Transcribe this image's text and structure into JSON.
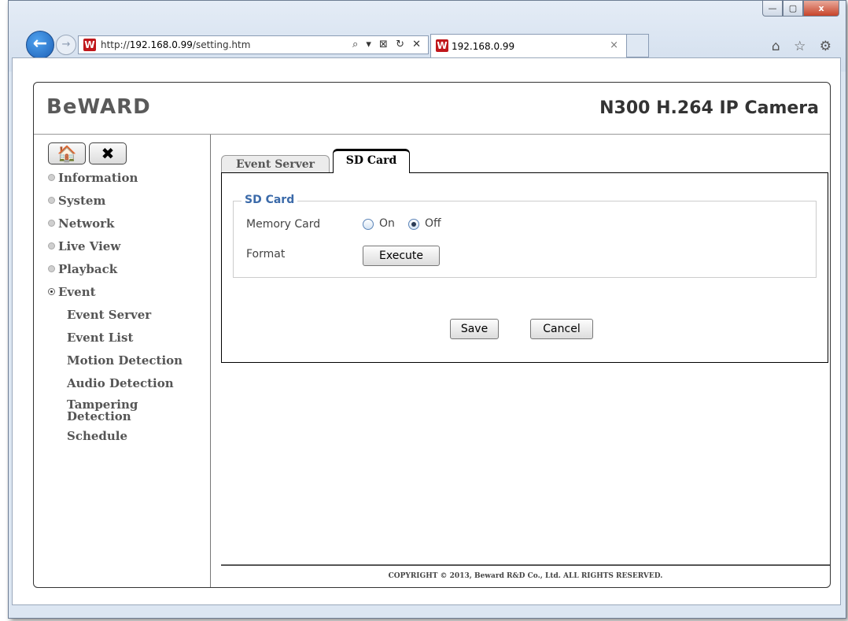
{
  "browser": {
    "url_prefix": "http://",
    "url_host": "192.168.0.99",
    "url_path": "/setting.htm",
    "tab_title": "192.168.0.99",
    "favicon_glyph": "W",
    "address_tools": "⌕ ▾ ⊠ ↻ ✕",
    "nav_icons": "⌂ ☆ ⚙",
    "back_glyph": "←",
    "forward_glyph": "→",
    "close_tab_glyph": "×",
    "window_minimize": "—",
    "window_maximize": "▢",
    "window_close": "x"
  },
  "header": {
    "logo": "BeWARD",
    "model": "N300 H.264 IP Camera"
  },
  "sidebar": {
    "home_icon": "🏠",
    "tools_icon": "✖",
    "menu": [
      {
        "label": "Information"
      },
      {
        "label": "System"
      },
      {
        "label": "Network"
      },
      {
        "label": "Live View"
      },
      {
        "label": "Playback"
      },
      {
        "label": "Event"
      }
    ],
    "submenu": [
      {
        "label": "Event Server"
      },
      {
        "label": "Event List"
      },
      {
        "label": "Motion Detection"
      },
      {
        "label": "Audio Detection"
      },
      {
        "label": "Tampering Detection"
      },
      {
        "label": "Schedule"
      }
    ]
  },
  "tabs": [
    {
      "label": "Event Server"
    },
    {
      "label": "SD Card"
    }
  ],
  "sd_card": {
    "legend": "SD Card",
    "memory_card_label": "Memory Card",
    "on_label": "On",
    "off_label": "Off",
    "selected": "Off",
    "format_label": "Format",
    "execute_label": "Execute"
  },
  "actions": {
    "save_label": "Save",
    "cancel_label": "Cancel"
  },
  "footer": {
    "copyright": "COPYRIGHT © 2013, Beward R&D Co., Ltd. ALL RIGHTS RESERVED."
  }
}
